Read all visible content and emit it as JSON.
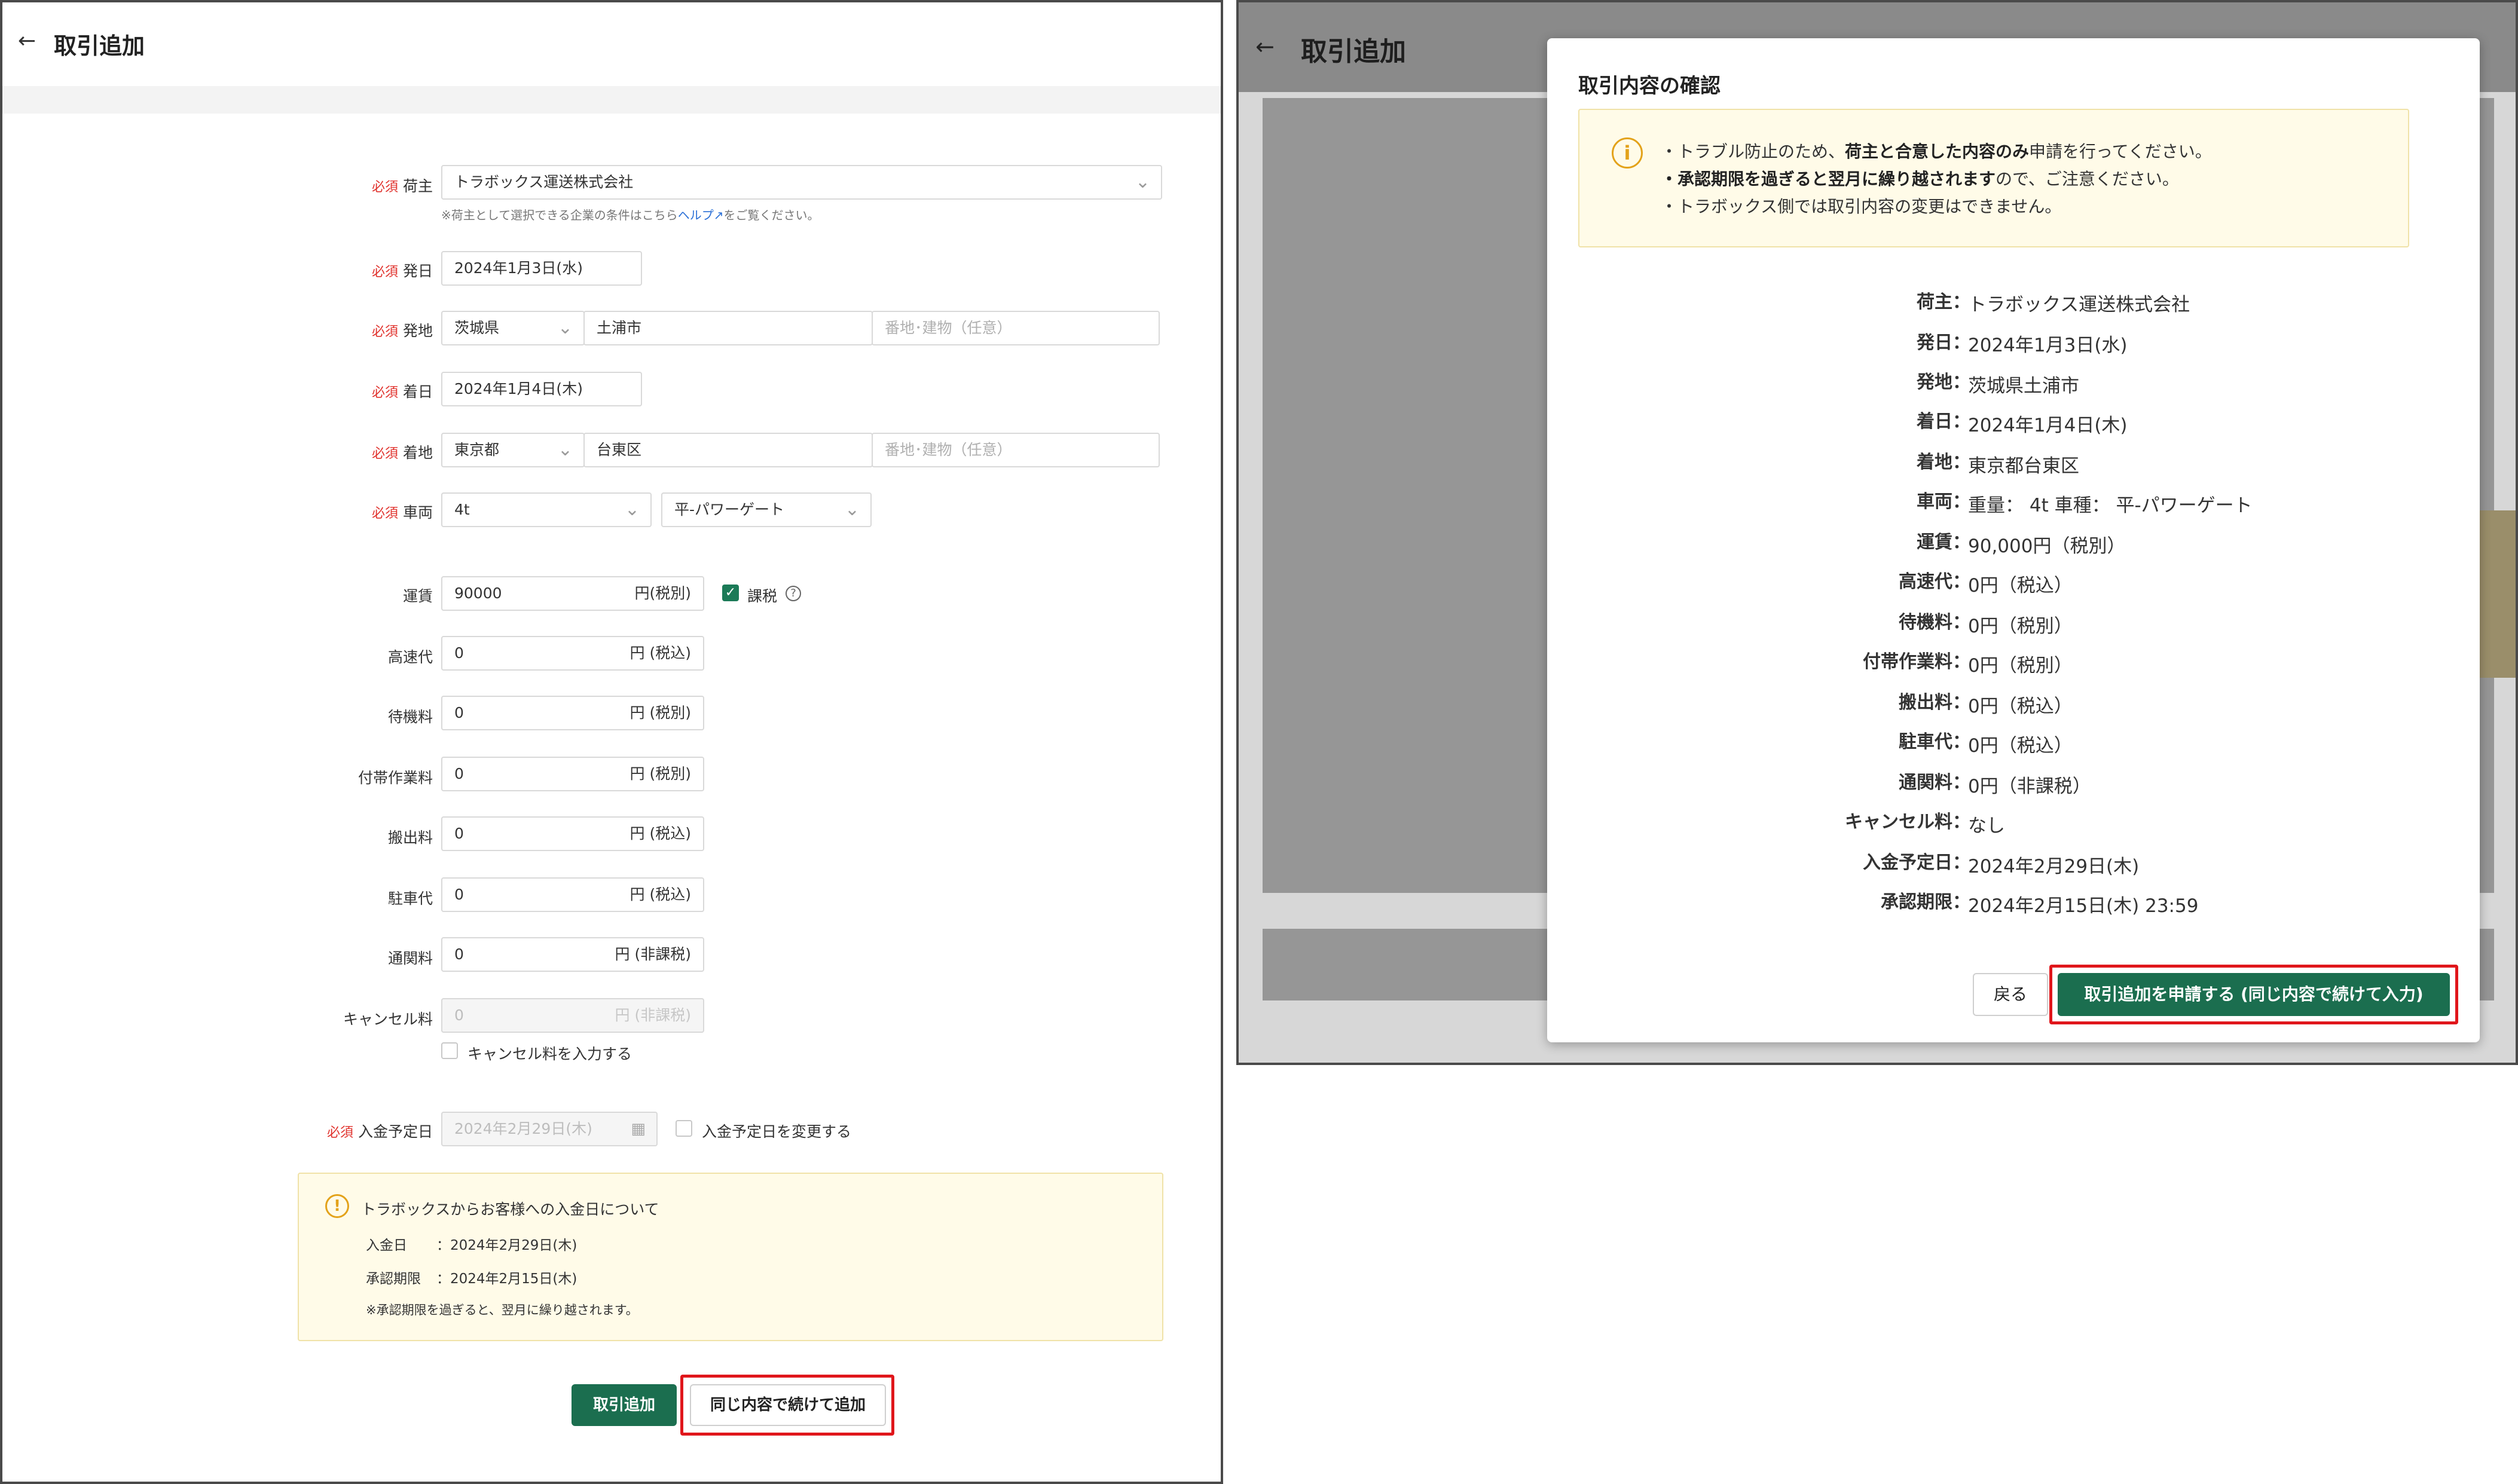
{
  "left": {
    "back_icon": "arrow-left-icon",
    "title": "取引追加",
    "required_mark": "必須",
    "shipper": {
      "label": "荷主",
      "value": "トラボックス運送株式会社",
      "note_prefix": "※荷主として選択できる企業の条件はこちら",
      "note_link": "ヘルプ",
      "note_suffix": "をご覧ください。"
    },
    "departure_date": {
      "label": "発日",
      "value": "2024年1月3日(水)"
    },
    "origin": {
      "label": "発地",
      "prefecture": "茨城県",
      "city": "土浦市",
      "address_placeholder": "番地･建物（任意）"
    },
    "arrival_date": {
      "label": "着日",
      "value": "2024年1月4日(木)"
    },
    "destination": {
      "label": "着地",
      "prefecture": "東京都",
      "city": "台東区",
      "address_placeholder": "番地･建物（任意）"
    },
    "vehicle": {
      "label": "車両",
      "weight": "4t",
      "type": "平-パワーゲート"
    },
    "fees": [
      {
        "label": "運賃",
        "value": "90000",
        "unit": "円(税別)"
      },
      {
        "label": "高速代",
        "value": "0",
        "unit": "円 (税込)"
      },
      {
        "label": "待機料",
        "value": "0",
        "unit": "円 (税別)"
      },
      {
        "label": "付帯作業料",
        "value": "0",
        "unit": "円 (税別)"
      },
      {
        "label": "搬出料",
        "value": "0",
        "unit": "円 (税込)"
      },
      {
        "label": "駐車代",
        "value": "0",
        "unit": "円 (税込)"
      },
      {
        "label": "通関料",
        "value": "0",
        "unit": "円 (非課税)"
      },
      {
        "label": "キャンセル料",
        "value": "0",
        "unit": "円 (非課税)"
      }
    ],
    "taxable_label": "課税",
    "cancel_checkbox_label": "キャンセル料を入力する",
    "payment_date": {
      "label": "入金予定日",
      "value": "2024年2月29日(木)",
      "checkbox_label": "入金予定日を変更する"
    },
    "info": {
      "title": "トラボックスからお客様への入金日について",
      "payment_label": "入金日",
      "payment_value": "：2024年2月29日(木)",
      "deadline_label": "承認期限",
      "deadline_value": "：2024年2月15日(木)",
      "note": "※承認期限を過ぎると、翌月に繰り越されます。"
    },
    "buttons": {
      "add": "取引追加",
      "add_continue": "同じ内容で続けて追加"
    }
  },
  "right": {
    "title": "取引追加",
    "modal": {
      "title": "取引内容の確認",
      "notice": {
        "line1_pre": "・トラブル防止のため、",
        "line1_bold": "荷主と合意した内容のみ",
        "line1_post": "申請を行ってください。",
        "line2_bold": "・承認期限を過ぎると翌月に繰り越されます",
        "line2_post": "ので、ご注意ください。",
        "line3": "・トラボックス側では取引内容の変更はできません。"
      },
      "summary": [
        {
          "label": "荷主：",
          "value": "トラボックス運送株式会社"
        },
        {
          "label": "発日：",
          "value": "2024年1月3日(水)"
        },
        {
          "label": "発地：",
          "value": "茨城県土浦市"
        },
        {
          "label": "着日：",
          "value": "2024年1月4日(木)"
        },
        {
          "label": "着地：",
          "value": "東京都台東区"
        },
        {
          "label": "車両：",
          "value": "重量： 4t 車種： 平-パワーゲート"
        },
        {
          "label": "運賃：",
          "value": "90,000円（税別）"
        },
        {
          "label": "高速代：",
          "value": "0円（税込）"
        },
        {
          "label": "待機料：",
          "value": "0円（税別）"
        },
        {
          "label": "付帯作業料：",
          "value": "0円（税別）"
        },
        {
          "label": "搬出料：",
          "value": "0円（税込）"
        },
        {
          "label": "駐車代：",
          "value": "0円（税込）"
        },
        {
          "label": "通関料：",
          "value": "0円（非課税）"
        },
        {
          "label": "キャンセル料：",
          "value": "なし"
        },
        {
          "label": "入金予定日：",
          "value": "2024年2月29日(木)"
        },
        {
          "label": "承認期限：",
          "value": "2024年2月15日(木) 23:59"
        }
      ],
      "buttons": {
        "back": "戻る",
        "submit_continue": "取引追加を申請する (同じ内容で続けて入力)"
      }
    }
  },
  "colors": {
    "primary": "#1b6e4f",
    "required": "#e0312c",
    "highlight_frame": "#e0161b",
    "notice_bg": "#fffbe8",
    "warning": "#e3a21a"
  }
}
